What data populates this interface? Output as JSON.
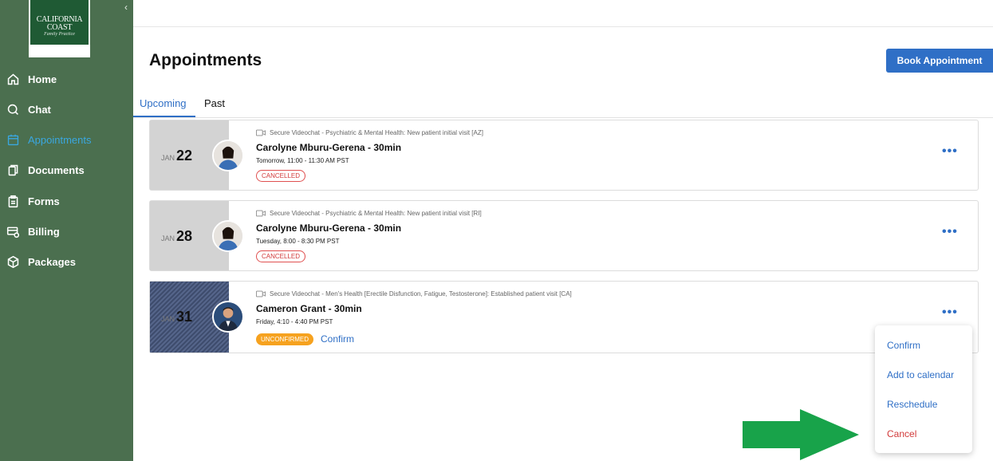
{
  "brand": {
    "logo_title": "CALIFORNIA COAST",
    "logo_subtitle": "Family Practice",
    "accent": "#2f6fc6",
    "sidebar_bg": "#4b6f4f"
  },
  "sidebar": {
    "collapse_icon": "chevron-left-icon",
    "items": [
      {
        "label": "Home",
        "icon": "home-icon"
      },
      {
        "label": "Chat",
        "icon": "chat-icon"
      },
      {
        "label": "Appointments",
        "icon": "calendar-icon",
        "active": true
      },
      {
        "label": "Documents",
        "icon": "document-icon"
      },
      {
        "label": "Forms",
        "icon": "clipboard-icon"
      },
      {
        "label": "Billing",
        "icon": "billing-icon"
      },
      {
        "label": "Packages",
        "icon": "package-icon"
      }
    ]
  },
  "header": {
    "title": "Appointments",
    "book_button": "Book Appointment"
  },
  "tabs": [
    {
      "label": "Upcoming",
      "active": true
    },
    {
      "label": "Past",
      "active": false
    }
  ],
  "appointments": [
    {
      "month": "JAN",
      "day": "22",
      "visit": "Secure Videochat - Psychiatric & Mental Health: New patient initial visit [AZ]",
      "provider": "Carolyne Mburu-Gerena - 30min",
      "when": "Tomorrow, 11:00 - 11:30 AM PST",
      "status": "CANCELLED",
      "more": "•••"
    },
    {
      "month": "JAN",
      "day": "28",
      "visit": "Secure Videochat - Psychiatric & Mental Health: New patient initial visit [RI]",
      "provider": "Carolyne Mburu-Gerena - 30min",
      "when": "Tuesday, 8:00 - 8:30 PM PST",
      "status": "CANCELLED",
      "more": "•••"
    },
    {
      "month": "JAN",
      "day": "31",
      "visit": "Secure Videochat - Men's Health [Erectile Disfunction, Fatigue, Testosterone]: Established patient visit [CA]",
      "provider": "Cameron Grant - 30min",
      "when": "Friday, 4:10 - 4:40 PM PST",
      "status": "UNCONFIRMED",
      "action": "Confirm",
      "more": "•••"
    }
  ],
  "menu": {
    "items": [
      "Confirm",
      "Add to calendar",
      "Reschedule",
      "Cancel"
    ]
  }
}
